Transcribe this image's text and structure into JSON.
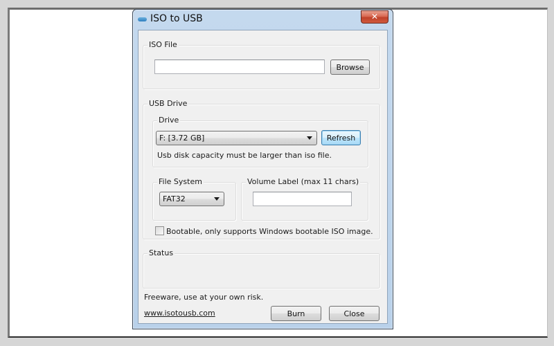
{
  "window": {
    "title": "ISO to USB",
    "app_icon": "usb-drive-icon",
    "close_glyph": "✕"
  },
  "iso_file": {
    "group_label": "ISO File",
    "path_value": "",
    "browse_label": "Browse"
  },
  "usb_drive": {
    "group_label": "USB Drive",
    "drive": {
      "group_label": "Drive",
      "selected": "F: [3.72 GB]",
      "refresh_label": "Refresh",
      "hint": "Usb disk capacity must be larger than iso file."
    },
    "file_system": {
      "group_label": "File System",
      "selected": "FAT32"
    },
    "volume_label": {
      "group_label": "Volume Label (max 11 chars)",
      "value": ""
    },
    "bootable": {
      "checked": false,
      "label": "Bootable, only supports Windows bootable ISO image."
    }
  },
  "status": {
    "group_label": "Status",
    "text": ""
  },
  "footer": {
    "disclaimer": "Freeware, use at your own risk.",
    "website": "www.isotousb.com",
    "burn_label": "Burn",
    "close_label": "Close"
  },
  "colors": {
    "titlebar": "#c4d9ee",
    "close_button": "#c0422a",
    "focus_button": "#3c7fb1",
    "client_bg": "#f0f0f0"
  }
}
